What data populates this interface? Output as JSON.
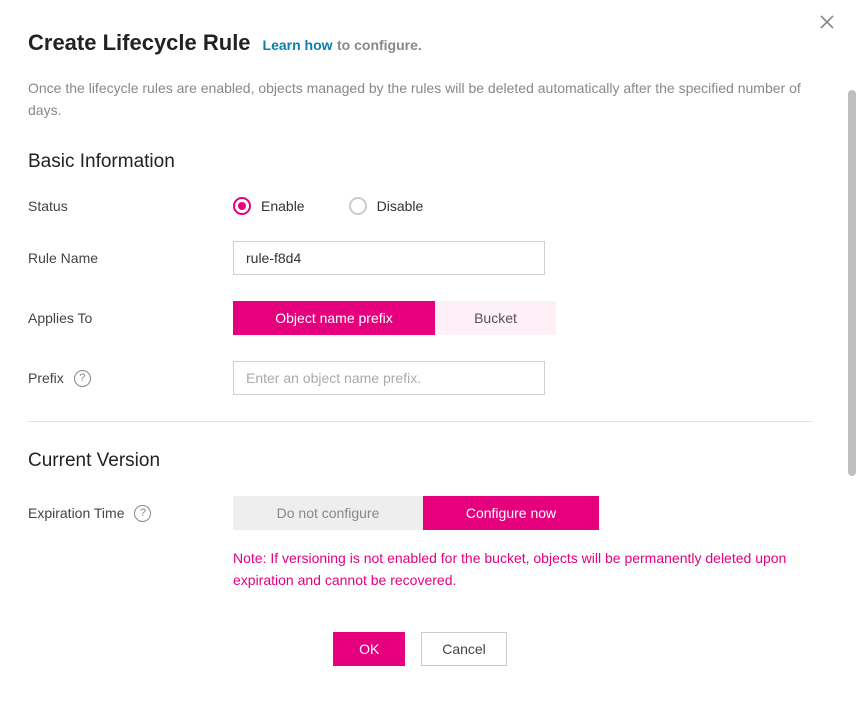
{
  "header": {
    "title": "Create Lifecycle Rule",
    "learn_link": "Learn how",
    "configure_suffix": "to configure."
  },
  "description": "Once the lifecycle rules are enabled, objects managed by the rules will be deleted automatically after the specified number of days.",
  "basic": {
    "section_title": "Basic Information",
    "status_label": "Status",
    "status_enable": "Enable",
    "status_disable": "Disable",
    "status_selected": "enable",
    "rule_name_label": "Rule Name",
    "rule_name_value": "rule-f8d4",
    "applies_to_label": "Applies To",
    "applies_prefix": "Object name prefix",
    "applies_bucket": "Bucket",
    "applies_selected": "prefix",
    "prefix_label": "Prefix",
    "prefix_placeholder": "Enter an object name prefix.",
    "prefix_value": ""
  },
  "current_version": {
    "section_title": "Current Version",
    "expiration_label": "Expiration Time",
    "do_not_configure": "Do not configure",
    "configure_now": "Configure now",
    "expiration_selected": "configure_now",
    "note": "Note: If versioning is not enabled for the bucket, objects will be permanently deleted upon expiration and cannot be recovered."
  },
  "footer": {
    "ok": "OK",
    "cancel": "Cancel"
  },
  "colors": {
    "accent": "#e6007e",
    "link": "#0b7fab"
  }
}
